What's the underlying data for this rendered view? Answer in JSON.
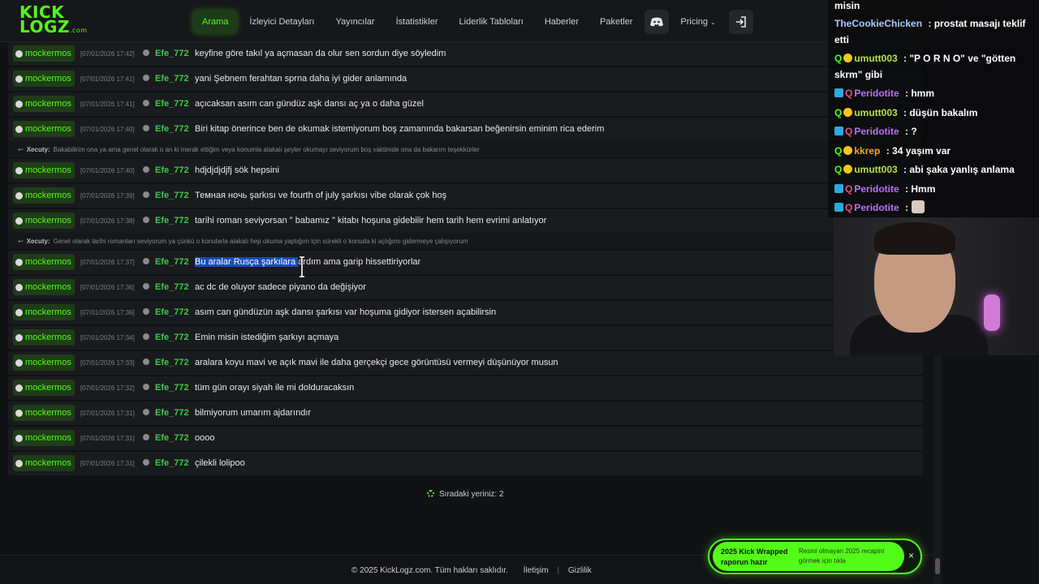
{
  "logo": {
    "line1": "KICK",
    "line2": "LOGZ",
    "suffix": ".com"
  },
  "nav": {
    "items": [
      "Arama",
      "İzleyici Detayları",
      "Yayıncılar",
      "İstatistikler",
      "Liderlik Tabloları",
      "Haberler",
      "Paketler"
    ],
    "pricing": "Pricing"
  },
  "rows": [
    {
      "channel": "mockermos",
      "time": "[07/01/2026 17:42]",
      "user": "Efe_772",
      "text": "keyfine göre takıl ya açmasan da olur sen sordun diye söyledim"
    },
    {
      "channel": "mockermos",
      "time": "[07/01/2026 17:41]",
      "user": "Efe_772",
      "text": "yani Şebnem ferahtan sprna daha iyi gider anlamında"
    },
    {
      "channel": "mockermos",
      "time": "[07/01/2026 17:41]",
      "user": "Efe_772",
      "text": "açıcaksan asım can gündüz aşk dansı aç ya o daha güzel"
    },
    {
      "channel": "mockermos",
      "time": "[07/01/2026 17:40]",
      "user": "Efe_772",
      "text": "Biri kitap önerince ben de okumak istemiyorum boş zamanında bakarsan beğenirsin eminim rica ederim"
    },
    {
      "channel": "mockermos",
      "time": "[07/01/2026 17:40]",
      "user": "Efe_772",
      "text": "hdjdjdjdjfj sök hepsini"
    },
    {
      "channel": "mockermos",
      "time": "[07/01/2026 17:39]",
      "user": "Efe_772",
      "text": "Темная ночь şarkısı ve fourth of july şarkısı vibe olarak çok hoş"
    },
    {
      "channel": "mockermos",
      "time": "[07/01/2026 17:38]",
      "user": "Efe_772",
      "text": "tarihi roman seviyorsan \" babamız \" kitabı hoşuna gidebilir hem tarih hem evrimi anlatıyor"
    },
    {
      "channel": "mockermos",
      "time": "[07/01/2026 17:37]",
      "user": "Efe_772",
      "text_selected": "Bu aralar Rusça şarkılara ",
      "text_rest": "ardım ama garip hissettiriyorlar"
    },
    {
      "channel": "mockermos",
      "time": "[07/01/2026 17:36]",
      "user": "Efe_772",
      "text": "ac dc de oluyor sadece piyano da değişiyor"
    },
    {
      "channel": "mockermos",
      "time": "[07/01/2026 17:36]",
      "user": "Efe_772",
      "text": "asım can gündüzün aşk dansı şarkısı var hoşuma gidiyor istersen açabilirsin"
    },
    {
      "channel": "mockermos",
      "time": "[07/01/2026 17:34]",
      "user": "Efe_772",
      "text": "Emin misin istediğim şarkıyı açmaya"
    },
    {
      "channel": "mockermos",
      "time": "[07/01/2026 17:33]",
      "user": "Efe_772",
      "text": "aralara koyu mavi ve açık mavi ile daha gerçekçi gece görüntüsü vermeyi düşünüyor musun"
    },
    {
      "channel": "mockermos",
      "time": "[07/01/2026 17:32]",
      "user": "Efe_772",
      "text": "tüm gün orayı siyah ile mi dolduracaksın"
    },
    {
      "channel": "mockermos",
      "time": "[07/01/2026 17:31]",
      "user": "Efe_772",
      "text": "bilmiyorum umarım ajdarındır"
    },
    {
      "channel": "mockermos",
      "time": "[07/01/2026 17:31]",
      "user": "Efe_772",
      "text": "oooo"
    },
    {
      "channel": "mockermos",
      "time": "[07/01/2026 17:31]",
      "user": "Efe_772",
      "text": "çilekli lolipoo"
    }
  ],
  "replies": [
    {
      "name": "Xecuty:",
      "text": "Bakabilirim ona ya ama genel olarak o an ki merak ettiğim veya konumla alakalı şeyler okumayı seviyorum boş vaktimde ona da bakarım teşekkürler"
    },
    {
      "name": "Xecuty:",
      "text": "Genel olarak tarihi romanları seviyorum ya çünkü o konularla alakalı hep okuma yaptığım için sürekli o konuda ki açlığımı gidermeye çalışıyorum"
    }
  ],
  "queue": "Sıradaki yeriniz: 2",
  "footer": {
    "copyright": "© 2025 KickLogz.com. Tüm hakları saklıdır.",
    "contact": "İletişim",
    "privacy": "Gizlilik"
  },
  "toast": {
    "title": "2025 Kick Wrapped raporun hazır",
    "desc": "Resmi olmayan 2025 recapini görmek için tıkla",
    "close": "×"
  },
  "stream_chat": [
    {
      "text": "misin"
    },
    {
      "name": "TheCookieChicken",
      "name_color": "#a8c8ff",
      "text": " : prostat masajı teklif"
    },
    {
      "text": "etti"
    },
    {
      "name": "umutt003",
      "name_color": "#b6e04a",
      "text": " : \"P O R N O\" ve \"götten"
    },
    {
      "text": "skrm\" gibi"
    },
    {
      "name": "Peridotite",
      "name_color": "#b873f0",
      "text": " : hmm"
    },
    {
      "name": "umutt003",
      "name_color": "#b6e04a",
      "text": " : düşün bakalım"
    },
    {
      "name": "Peridotite",
      "name_color": "#b873f0",
      "text": " : ?"
    },
    {
      "name": "kkrep",
      "name_color": "#f0a030",
      "text": " : 34 yaşım var"
    },
    {
      "name": "umutt003",
      "name_color": "#b6e04a",
      "text": " : abi şaka yanlış anlama"
    },
    {
      "name": "Peridotite",
      "name_color": "#b873f0",
      "text": " : Hmm"
    },
    {
      "name": "Peridotite",
      "name_color": "#b873f0",
      "text": " :"
    }
  ],
  "colors": {
    "accent": "#53fc18",
    "user": "#3ec94a",
    "selection": "#1a4bb8"
  }
}
